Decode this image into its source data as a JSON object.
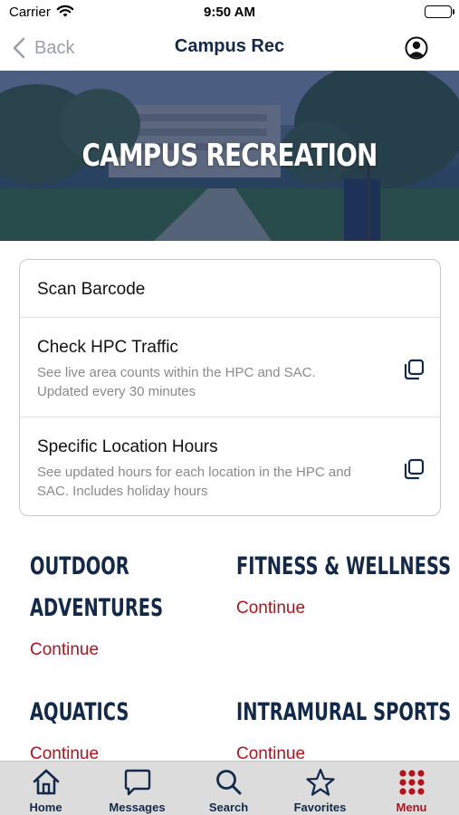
{
  "status_bar": {
    "carrier": "Carrier",
    "time": "9:50 AM"
  },
  "nav": {
    "back_label": "Back",
    "title": "Campus Rec"
  },
  "hero": {
    "title": "CAMPUS RECREATION"
  },
  "card": {
    "rows": [
      {
        "title": "Scan Barcode"
      },
      {
        "title": "Check HPC Traffic",
        "desc_line1": "See live area counts within the HPC and SAC.",
        "desc_line2": "Updated every 30 minutes",
        "icon": "external-link-icon"
      },
      {
        "title": "Specific Location Hours",
        "desc_line1": "See updated hours for each location in the HPC and",
        "desc_line2": "SAC. Includes holiday hours",
        "icon": "external-link-icon"
      }
    ]
  },
  "tiles": [
    {
      "heading_line1": "OUTDOOR",
      "heading_line2": "ADVENTURES",
      "link": "Continue"
    },
    {
      "heading_line1": "FITNESS & WELLNESS",
      "link": "Continue"
    },
    {
      "heading_line1": "AQUATICS",
      "link": "Continue"
    },
    {
      "heading_line1": "INTRAMURAL SPORTS",
      "link": "Continue"
    }
  ],
  "tab_bar": {
    "active": "Menu",
    "tabs": [
      {
        "label": "Home",
        "icon": "home-icon"
      },
      {
        "label": "Messages",
        "icon": "chat-icon"
      },
      {
        "label": "Search",
        "icon": "search-icon"
      },
      {
        "label": "Favorites",
        "icon": "star-icon"
      },
      {
        "label": "Menu",
        "icon": "grid-menu-icon"
      }
    ]
  },
  "colors": {
    "navy": "#13294b",
    "red": "#b5121b",
    "gray_text": "#8a8a8a",
    "tab_bar_bg": "#dcdcdc"
  }
}
